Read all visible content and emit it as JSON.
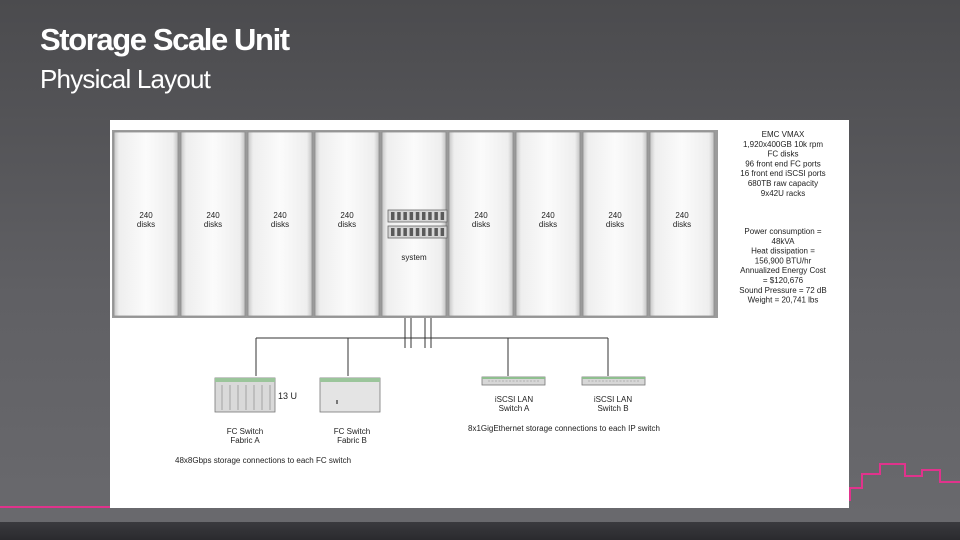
{
  "slide": {
    "title": "Storage Scale Unit",
    "subtitle": "Physical Layout"
  },
  "diagram": {
    "racks": [
      {
        "label_line1": "240",
        "label_line2": "disks"
      },
      {
        "label_line1": "240",
        "label_line2": "disks"
      },
      {
        "label_line1": "240",
        "label_line2": "disks"
      },
      {
        "label_line1": "240",
        "label_line2": "disks"
      },
      {
        "label_line1": "system",
        "label_line2": ""
      },
      {
        "label_line1": "240",
        "label_line2": "disks"
      },
      {
        "label_line1": "240",
        "label_line2": "disks"
      },
      {
        "label_line1": "240",
        "label_line2": "disks"
      },
      {
        "label_line1": "240",
        "label_line2": "disks"
      }
    ],
    "specs": [
      "EMC VMAX",
      "1,920x400GB 10k rpm",
      "FC disks",
      "96 front end FC ports",
      "16 front end iSCSI ports",
      "680TB raw capacity",
      "9x42U racks"
    ],
    "power": [
      "Power consumption =",
      "48kVA",
      "Heat dissipation =",
      "156,900 BTU/hr",
      "Annualized Energy Cost",
      "= $120,676",
      "Sound Pressure = 72 dB",
      "Weight = 20,741 lbs"
    ],
    "fc_switch_a": {
      "line1": "FC Switch",
      "line2": "Fabric A"
    },
    "fc_switch_b": {
      "line1": "FC Switch",
      "line2": "Fabric B"
    },
    "height_label": "13 U",
    "iscsi_a": {
      "line1": "iSCSI LAN",
      "line2": "Switch A"
    },
    "iscsi_b": {
      "line1": "iSCSI LAN",
      "line2": "Switch B"
    },
    "fc_connections": "48x8Gbps storage connections to each FC switch",
    "ip_connections": "8x1GigEthernet storage connections to each IP switch"
  }
}
